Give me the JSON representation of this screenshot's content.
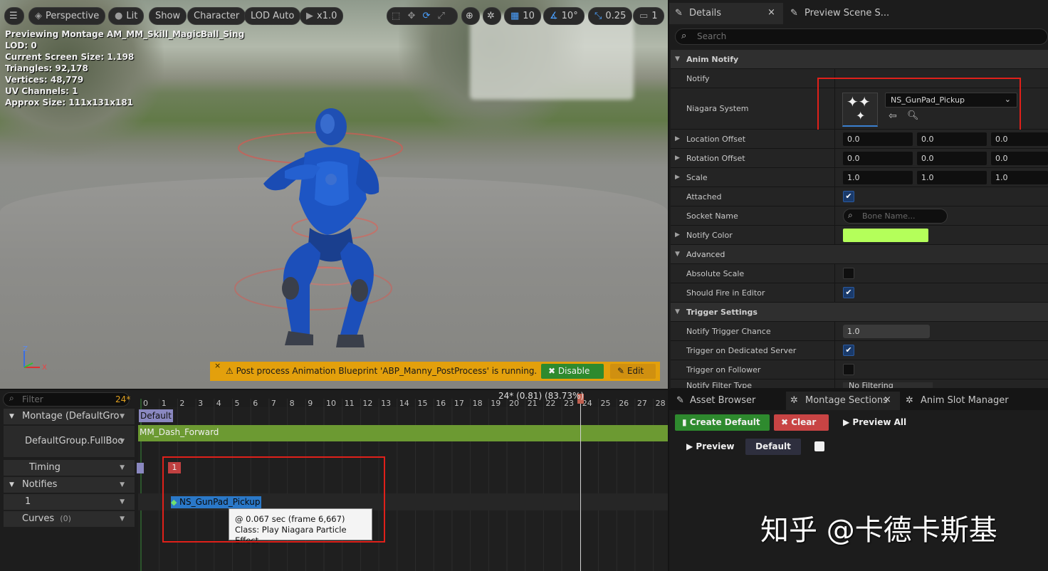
{
  "viewport": {
    "toolbar": {
      "perspective": "Perspective",
      "lit": "Lit",
      "show": "Show",
      "character": "Character",
      "lod": "LOD Auto",
      "speed": "x1.0",
      "grid": "10",
      "angle": "10°",
      "scale": "0.25",
      "camera": "1"
    },
    "stats": [
      "Previewing Montage AM_MM_Skill_MagicBall_Sing",
      "LOD: 0",
      "Current Screen Size: 1.198",
      "Triangles: 92,178",
      "Vertices: 48,779",
      "UV Channels: 1",
      "Approx Size: 111x131x181"
    ],
    "axis": {
      "z": "Z",
      "x": "X"
    },
    "banner": {
      "text": "Post process Animation Blueprint 'ABP_Manny_PostProcess' is running.",
      "disable": "Disable",
      "edit": "Edit"
    }
  },
  "details": {
    "tabs": {
      "details": "Details",
      "preview": "Preview Scene S..."
    },
    "search_placeholder": "Search",
    "rows": {
      "anim_notify": "Anim Notify",
      "notify": "Notify",
      "niagara_system": "Niagara System",
      "niagara_value": "NS_GunPad_Pickup",
      "location_offset": "Location Offset",
      "rotation_offset": "Rotation Offset",
      "scale": "Scale",
      "attached": "Attached",
      "socket_name": "Socket Name",
      "socket_placeholder": "Bone Name...",
      "notify_color": "Notify Color",
      "advanced": "Advanced",
      "absolute_scale": "Absolute Scale",
      "should_fire": "Should Fire in Editor",
      "trigger_settings": "Trigger Settings",
      "notify_trigger_chance": "Notify Trigger Chance",
      "trigger_dedicated": "Trigger on Dedicated Server",
      "trigger_follower": "Trigger on Follower",
      "notify_filter_type": "Notify Filter Type",
      "notify_filter_value": "No Filtering"
    },
    "values": {
      "location": [
        "0.0",
        "0.0",
        "0.0"
      ],
      "rotation": [
        "0.0",
        "0.0",
        "0.0"
      ],
      "scale": [
        "1.0",
        "1.0",
        "1.0"
      ],
      "trigger_chance": "1.0",
      "attached": true,
      "absolute_scale": false,
      "should_fire": true,
      "dedicated": true,
      "follower": false
    },
    "notify_color": "#b4ff5a"
  },
  "timeline": {
    "filter_placeholder": "Filter",
    "fps": "24*",
    "playhead_label": "24* (0.81) (83.73%)",
    "ticks": [
      "0",
      "1",
      "2",
      "3",
      "4",
      "5",
      "6",
      "7",
      "8",
      "9",
      "10",
      "11",
      "12",
      "13",
      "14",
      "15",
      "16",
      "17",
      "18",
      "19",
      "20",
      "21",
      "22",
      "23",
      "24",
      "25",
      "26",
      "27",
      "28"
    ],
    "tracks": {
      "montage": "Montage (DefaultGro",
      "slot": "DefaultGroup.FullBoc",
      "timing": "Timing",
      "notifies": "Notifies",
      "notify_track": "1",
      "curves": "Curves",
      "curves_count": "(0)"
    },
    "section_label": "Default",
    "segment_label": "MM_Dash_Forward",
    "timing_marker": "1",
    "notify_label": "NS_GunPad_Pickup",
    "tooltip": [
      "@ 0.067 sec (frame 6,667)",
      "Class: Play Niagara Particle Effect"
    ]
  },
  "bottom": {
    "tabs": {
      "asset_browser": "Asset Browser",
      "montage_sections": "Montage Sections",
      "anim_slot": "Anim Slot Manager"
    },
    "create_default": "Create Default",
    "clear": "Clear",
    "preview_all": "Preview All",
    "preview": "Preview",
    "default": "Default",
    "watermark": "知乎 @卡德卡斯基"
  }
}
